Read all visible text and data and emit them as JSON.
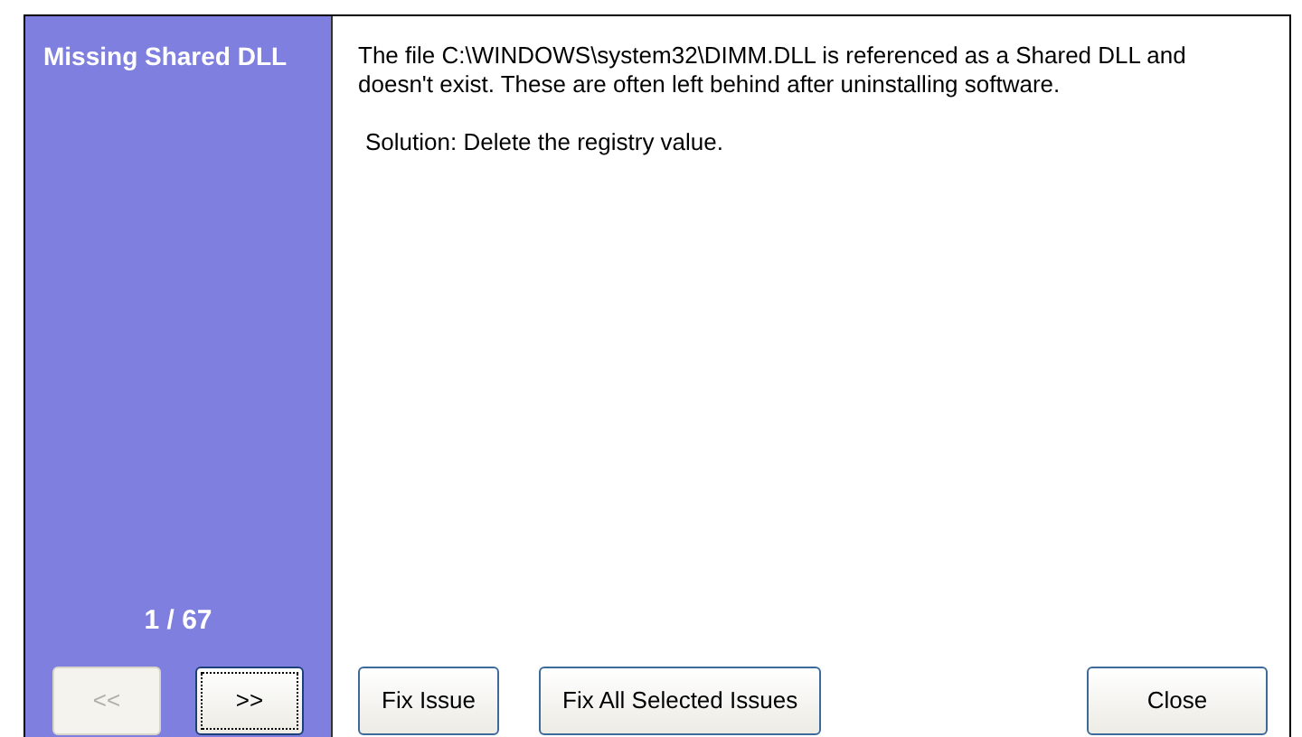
{
  "sidebar": {
    "title": "Missing Shared DLL",
    "counter": "1 / 67",
    "nav_buttons": [
      {
        "label": "<<",
        "disabled": true,
        "focused": false
      },
      {
        "label": ">>",
        "disabled": false,
        "focused": true
      }
    ]
  },
  "content": {
    "description": "The file C:\\WINDOWS\\system32\\DIMM.DLL is referenced as a Shared DLL and doesn't exist. These are often left behind after uninstalling software.",
    "solution": "Solution: Delete the registry value."
  },
  "buttons": [
    {
      "label": "Fix Issue",
      "kind": "left"
    },
    {
      "label": "Fix All Selected Issues",
      "kind": "left"
    },
    {
      "label": "Close",
      "kind": "right"
    }
  ]
}
